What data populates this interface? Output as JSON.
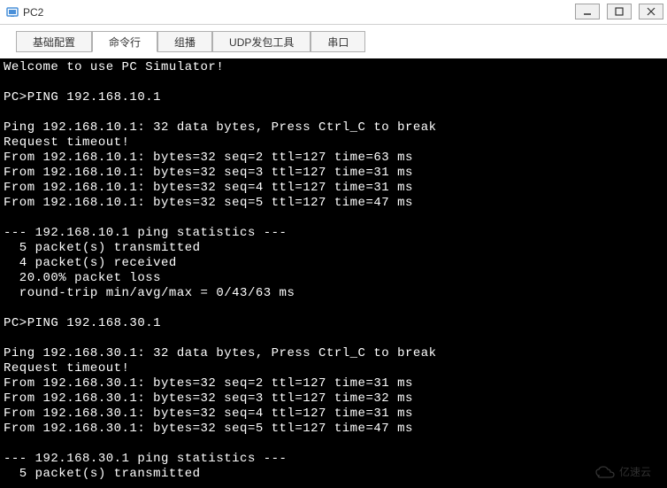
{
  "window": {
    "title": "PC2"
  },
  "tabs": {
    "t0": "基础配置",
    "t1": "命令行",
    "t2": "组播",
    "t3": "UDP发包工具",
    "t4": "串口"
  },
  "terminal": {
    "content": "Welcome to use PC Simulator!\n\nPC>PING 192.168.10.1\n\nPing 192.168.10.1: 32 data bytes, Press Ctrl_C to break\nRequest timeout!\nFrom 192.168.10.1: bytes=32 seq=2 ttl=127 time=63 ms\nFrom 192.168.10.1: bytes=32 seq=3 ttl=127 time=31 ms\nFrom 192.168.10.1: bytes=32 seq=4 ttl=127 time=31 ms\nFrom 192.168.10.1: bytes=32 seq=5 ttl=127 time=47 ms\n\n--- 192.168.10.1 ping statistics ---\n  5 packet(s) transmitted\n  4 packet(s) received\n  20.00% packet loss\n  round-trip min/avg/max = 0/43/63 ms\n\nPC>PING 192.168.30.1\n\nPing 192.168.30.1: 32 data bytes, Press Ctrl_C to break\nRequest timeout!\nFrom 192.168.30.1: bytes=32 seq=2 ttl=127 time=31 ms\nFrom 192.168.30.1: bytes=32 seq=3 ttl=127 time=32 ms\nFrom 192.168.30.1: bytes=32 seq=4 ttl=127 time=31 ms\nFrom 192.168.30.1: bytes=32 seq=5 ttl=127 time=47 ms\n\n--- 192.168.30.1 ping statistics ---\n  5 packet(s) transmitted"
  },
  "watermark": {
    "text": "亿速云"
  }
}
